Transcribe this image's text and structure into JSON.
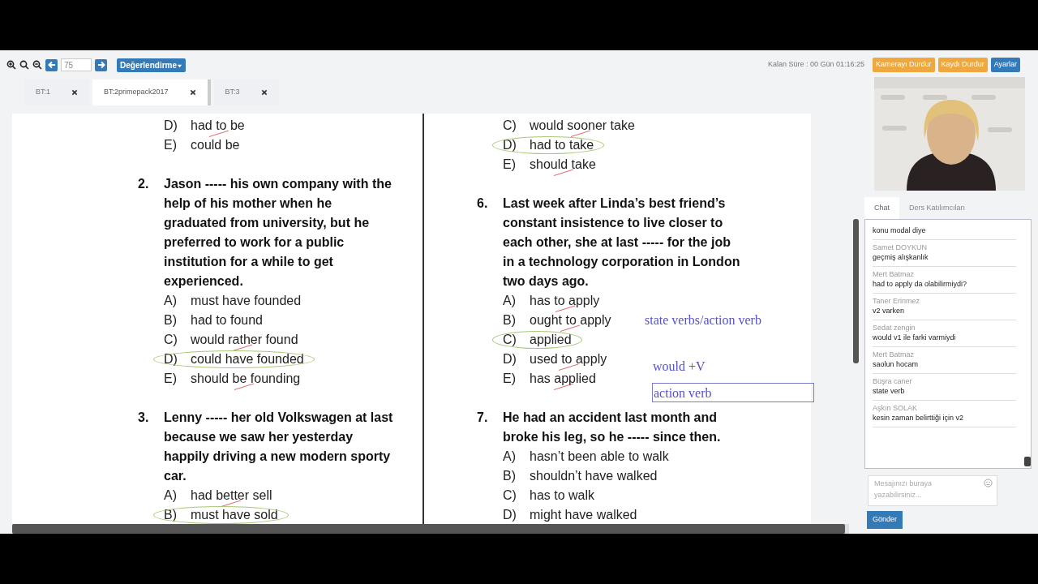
{
  "toolbar": {
    "page_input": "75",
    "menu_button": "Değerlendirme"
  },
  "tabs": [
    {
      "label": "BT:1",
      "selected": false
    },
    {
      "label": "BT:2primepack2017",
      "selected": true
    },
    {
      "label": "BT:3",
      "selected": false
    }
  ],
  "session": {
    "timer": "Kalan Süre : 00 Gün 01:16:25",
    "buttons": [
      {
        "label": "Kamerayı Durdur",
        "kind": "warning"
      },
      {
        "label": "Kaydı Durdur",
        "kind": "warning"
      },
      {
        "label": "Ayarlar",
        "kind": "primary"
      }
    ]
  },
  "document": {
    "columns": [
      {
        "blocks": [
          {
            "kind": "options",
            "options": [
              {
                "letter": "D)",
                "text": "had to be",
                "circled": false,
                "struck": true
              },
              {
                "letter": "E)",
                "text": "could be",
                "circled": false,
                "struck": false
              }
            ]
          },
          {
            "kind": "question",
            "number": "2.",
            "lines": [
              "Jason ----- his own company with the",
              "help of his mother when he",
              "graduated from university, but he",
              "preferred to work for a public",
              "institution for a while to get",
              "experienced."
            ],
            "options": [
              {
                "letter": "A)",
                "text": "must have founded",
                "circled": false,
                "struck": false
              },
              {
                "letter": "B)",
                "text": "had to found",
                "circled": false,
                "struck": false
              },
              {
                "letter": "C)",
                "text": "would rather found",
                "circled": false,
                "struck": true
              },
              {
                "letter": "D)",
                "text": "could have founded",
                "circled": true,
                "struck": false
              },
              {
                "letter": "E)",
                "text": "should be founding",
                "circled": false,
                "struck": true
              }
            ]
          },
          {
            "kind": "question",
            "number": "3.",
            "lines": [
              "Lenny ----- her old Volkswagen at last",
              "because we saw her yesterday",
              "happily driving a new modern sporty",
              "car."
            ],
            "options": [
              {
                "letter": "A)",
                "text": "had better sell",
                "circled": false,
                "struck": true
              },
              {
                "letter": "B)",
                "text": "must have sold",
                "circled": true,
                "struck": false
              }
            ]
          }
        ]
      },
      {
        "blocks": [
          {
            "kind": "options",
            "options": [
              {
                "letter": "C)",
                "text": "would sooner take",
                "circled": false,
                "struck": true
              },
              {
                "letter": "D)",
                "text": "had to take",
                "circled": true,
                "struck": false
              },
              {
                "letter": "E)",
                "text": "should take",
                "circled": false,
                "struck": true
              }
            ]
          },
          {
            "kind": "question",
            "number": "6.",
            "lines": [
              "Last week after Linda’s best friend’s",
              "constant insistence to live closer to",
              "each other, she at last ----- for the job",
              "in a technology corporation in London",
              "two days ago."
            ],
            "options": [
              {
                "letter": "A)",
                "text": "has to apply",
                "circled": false,
                "struck": true
              },
              {
                "letter": "B)",
                "text": "ought to apply",
                "circled": false,
                "struck": true
              },
              {
                "letter": "C)",
                "text": "applied",
                "circled": true,
                "struck": false
              },
              {
                "letter": "D)",
                "text": "used to apply",
                "circled": false,
                "struck": true
              },
              {
                "letter": "E)",
                "text": "has applied",
                "circled": false,
                "struck": true
              }
            ]
          },
          {
            "kind": "question",
            "number": "7.",
            "lines": [
              "He had an accident last month and",
              "broke his leg, so he ----- since then."
            ],
            "options": [
              {
                "letter": "A)",
                "text": "hasn’t been able to walk",
                "circled": false,
                "struck": false
              },
              {
                "letter": "B)",
                "text": "shouldn’t have walked",
                "circled": false,
                "struck": false
              },
              {
                "letter": "C)",
                "text": "has to walk",
                "circled": false,
                "struck": false
              },
              {
                "letter": "D)",
                "text": "might have walked",
                "circled": false,
                "struck": false
              }
            ]
          }
        ]
      }
    ],
    "annotations": [
      {
        "kind": "ink",
        "text": "state verbs/action verb"
      },
      {
        "kind": "ink",
        "text": "would +V"
      },
      {
        "kind": "textbox",
        "text": "action verb"
      }
    ]
  },
  "chat": {
    "tabs": [
      {
        "label": "Chat",
        "selected": true
      },
      {
        "label": "Ders Katılımcıları",
        "selected": false
      }
    ],
    "messages": [
      {
        "text": "konu modal diye"
      },
      {
        "author": "Samet DOYKUN",
        "text": "geçmiş alışkanlık"
      },
      {
        "author": "Mert Batmaz",
        "text": "had to apply da olabilirmiydi?"
      },
      {
        "author": "Taner Erinmez",
        "text": "v2 varken"
      },
      {
        "author": "Sedat zengin",
        "text": "would v1 ile farki varmiydi"
      },
      {
        "author": "Mert Batmaz",
        "text": "saolun hocam"
      },
      {
        "author": "Büşra caner",
        "text": "state verb"
      },
      {
        "author": "Aşkın SOLAK",
        "text": "kesin zaman belirttiği için v2"
      }
    ],
    "input": {
      "placeholder": "Mesajınızı buraya yazabilirsiniz..."
    },
    "send_button": "Gönder"
  }
}
